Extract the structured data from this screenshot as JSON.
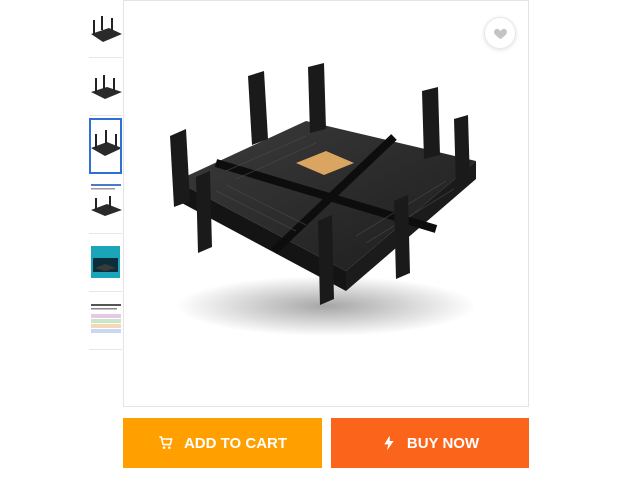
{
  "product": {
    "thumbnails": [
      {
        "name": "router-angle-1"
      },
      {
        "name": "router-angle-2"
      },
      {
        "name": "router-angle-3",
        "selected": true
      },
      {
        "name": "router-spec-sheet"
      },
      {
        "name": "router-box"
      },
      {
        "name": "router-comparison-table"
      }
    ],
    "main_image": "router-product-photo",
    "wishlist_icon": "heart-icon"
  },
  "actions": {
    "add_to_cart_label": "ADD TO CART",
    "buy_now_label": "BUY NOW",
    "add_to_cart_icon": "cart-icon",
    "buy_now_icon": "lightning-icon"
  },
  "colors": {
    "add_to_cart_bg": "#ff9f00",
    "buy_now_bg": "#fb641b",
    "selected_thumb_border": "#2f6fd6"
  }
}
